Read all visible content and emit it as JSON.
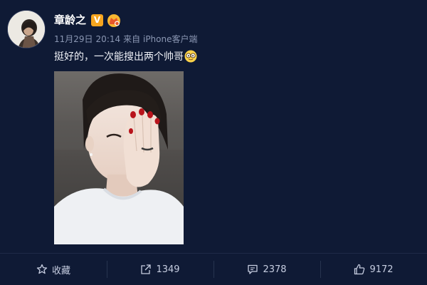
{
  "user": {
    "name": "章龄之",
    "verified_mark": "V"
  },
  "meta": {
    "date": "11月29日",
    "time": "20:14",
    "source_prefix": "来自",
    "source": "iPhone客户端"
  },
  "post": {
    "text": "挺好的，一次能搜出两个帅哥",
    "emoji": "nerd-face-emoji"
  },
  "actions": {
    "favorite_label": "收藏",
    "repost_count": "1349",
    "comment_count": "2378",
    "like_count": "9172"
  },
  "colors": {
    "background": "#0f1a35",
    "verified_orange": "#f6a51f",
    "meta_gray": "#8b97b3"
  }
}
